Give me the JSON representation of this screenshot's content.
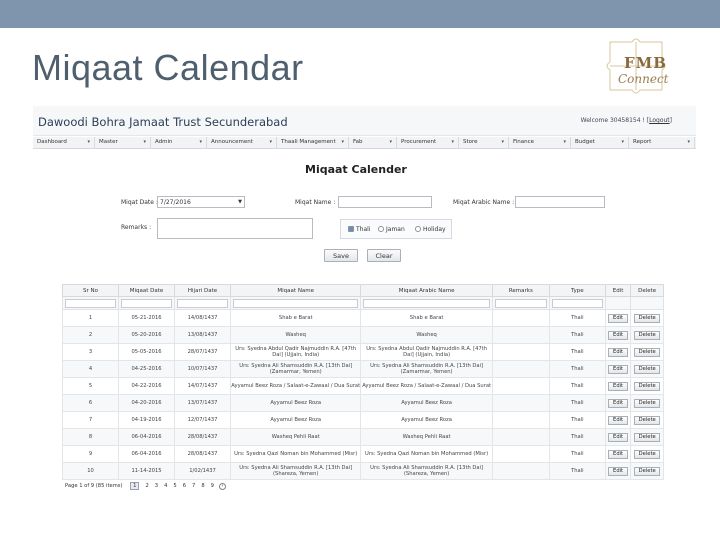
{
  "slide": {
    "title": "Miqaat Calendar",
    "logo_text_1": "FMB",
    "logo_text_2": "Connect"
  },
  "app": {
    "title": "Dawoodi Bohra Jamaat Trust Secunderabad",
    "welcome": "Welcome 30458154 !",
    "logout": "Logout"
  },
  "menu": [
    {
      "label": "Dashboard"
    },
    {
      "label": "Master"
    },
    {
      "label": "Admin"
    },
    {
      "label": "Announcement"
    },
    {
      "label": "Thaali Management"
    },
    {
      "label": "Fab"
    },
    {
      "label": "Procurement"
    },
    {
      "label": "Store"
    },
    {
      "label": "Finance"
    },
    {
      "label": "Budget"
    },
    {
      "label": "Report"
    }
  ],
  "form": {
    "heading": "Miqaat Calender",
    "miqaat_date_label": "Miqat Date :",
    "miqaat_date_value": "7/27/2016",
    "miqaat_name_label": "Miqat Name :",
    "miqaat_arabic_label": "Miqat Arabic Name :",
    "remarks_label": "Remarks :",
    "radio_thali": "Thali",
    "radio_jaman": "Jaman",
    "radio_holiday": "Holiday",
    "save": "Save",
    "clear": "Clear"
  },
  "table": {
    "headers": [
      "Sr No",
      "Miqaat Date",
      "Hijari Date",
      "Miqaat Name",
      "Miqaat Arabic Name",
      "Remarks",
      "Type",
      "Edit",
      "Delete"
    ],
    "edit_label": "Edit",
    "delete_label": "Delete",
    "rows": [
      [
        "1",
        "05-21-2016",
        "14/08/1437",
        "Shab e Barat",
        "Shab e Barat",
        "",
        "Thali"
      ],
      [
        "2",
        "05-20-2016",
        "13/08/1437",
        "Washeq",
        "Washeq",
        "",
        "Thali"
      ],
      [
        "3",
        "05-05-2016",
        "28/07/1437",
        "Urs: Syedna Abdul Qadir Najmuddin R.A. [47th Dai] (Ujjain, India)",
        "Urs: Syedna Abdul Qadir Najmuddin R.A. [47th Dai] (Ujjain, India)",
        "",
        "Thali"
      ],
      [
        "4",
        "04-25-2016",
        "10/07/1437",
        "Urs: Syedna Ali Shamsuddin R.A. [13th Dai] (Zamarmar, Yemen)",
        "Urs: Syedna Ali Shamsuddin R.A. [13th Dai] (Zamarmar, Yemen)",
        "",
        "Thali"
      ],
      [
        "5",
        "04-22-2016",
        "14/07/1437",
        "Ayyamul Beez Roza / Salaat-e-Zawaal / Dua Surat",
        "Ayyamul Beez Roza / Salaat-e-Zawaal / Dua Surat",
        "",
        "Thali"
      ],
      [
        "6",
        "04-20-2016",
        "13/07/1437",
        "Ayyamul Beez Roza",
        "Ayyamul Beez Roza",
        "",
        "Thali"
      ],
      [
        "7",
        "04-19-2016",
        "12/07/1437",
        "Ayyamul Beez Roza",
        "Ayyamul Beez Roza",
        "",
        "Thali"
      ],
      [
        "8",
        "06-04-2016",
        "28/08/1437",
        "Washeq Pehli Raat",
        "Washeq Pehli Raat",
        "",
        "Thali"
      ],
      [
        "9",
        "06-04-2016",
        "28/08/1437",
        "Urs: Syedna Qazi Noman bin Mohammed (Misr)",
        "Urs: Syedna Qazi Noman bin Mohammed (Misr)",
        "",
        "Thali"
      ],
      [
        "10",
        "11-14-2015",
        "1/02/1437",
        "Urs: Syedna Ali Shamsuddin R.A. [13th Dai] (Shareza, Yemen)",
        "Urs: Syedna Ali Shamsuddin R.A. [13th Dai] (Shareza, Yemen)",
        "",
        "Thali"
      ]
    ]
  },
  "pager": {
    "info": "Page 1 of 9 (85 items)",
    "pages": [
      "1",
      "2",
      "3",
      "4",
      "5",
      "6",
      "7",
      "8",
      "9"
    ],
    "next": "›"
  }
}
